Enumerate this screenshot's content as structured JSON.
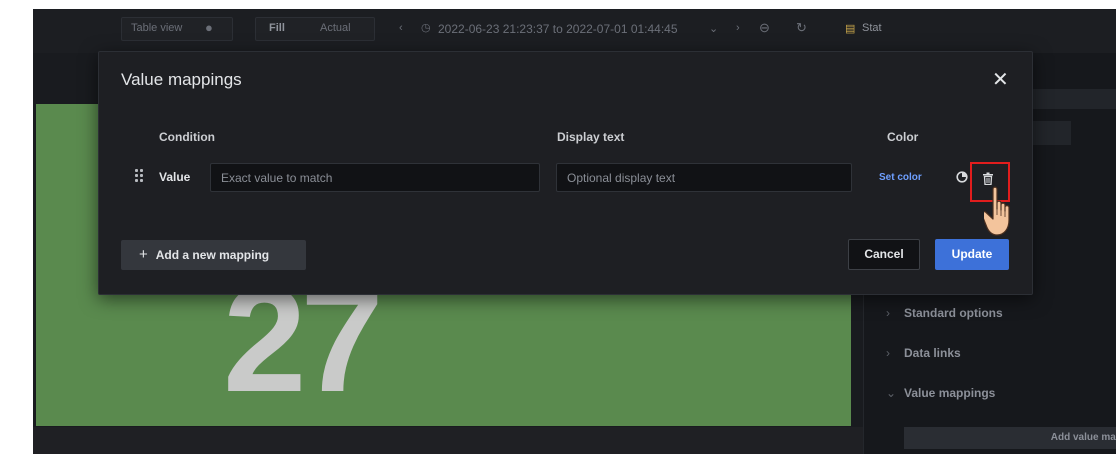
{
  "toolbar": {
    "table_view": "Table view",
    "fill": "Fill",
    "actual": "Actual",
    "time_range": "2022-06-23 21:23:37 to 2022-07-01 01:44:45",
    "visualization": "Stat"
  },
  "panel": {
    "big_value": "27"
  },
  "sidebar": {
    "items": [
      {
        "label": "Standard options",
        "expanded": false
      },
      {
        "label": "Data links",
        "expanded": false
      },
      {
        "label": "Value mappings",
        "expanded": true
      }
    ],
    "add_value_mapping": "Add value mapp"
  },
  "dialog": {
    "title": "Value mappings",
    "columns": {
      "condition": "Condition",
      "display_text": "Display text",
      "color": "Color"
    },
    "row": {
      "type": "Value",
      "value_placeholder": "Exact value to match",
      "display_placeholder": "Optional display text",
      "set_color": "Set color"
    },
    "add_mapping": "Add a new mapping",
    "cancel": "Cancel",
    "update": "Update"
  },
  "colors": {
    "primary": "#3d71d9",
    "highlight": "#e11d1d",
    "panel_green": "#5a8a4e",
    "link": "#6e9fff"
  },
  "icons": [
    "clock-icon",
    "zoom-out-icon",
    "refresh-icon",
    "close-icon",
    "drag-handle-icon",
    "copy-icon",
    "trash-icon",
    "pointer-hand-icon",
    "plus-icon"
  ]
}
